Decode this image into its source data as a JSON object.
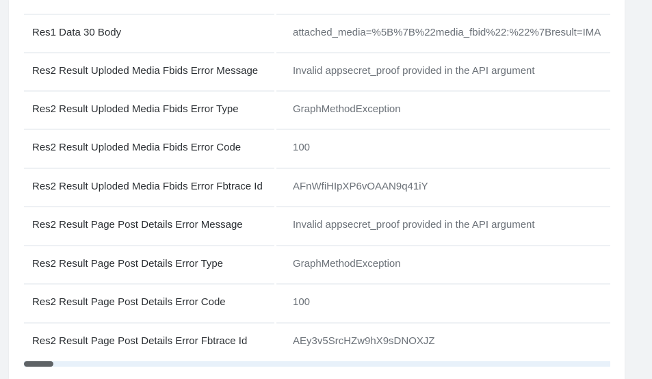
{
  "rows": [
    {
      "label": "Res1 Data 30 Body",
      "value": "attached_media=%5B%7B%22media_fbid%22:%22%7Bresult=IMA"
    },
    {
      "label": "Res2 Result Uploded Media Fbids Error Message",
      "value": "Invalid appsecret_proof provided in the API argument"
    },
    {
      "label": "Res2 Result Uploded Media Fbids Error Type",
      "value": "GraphMethodException"
    },
    {
      "label": "Res2 Result Uploded Media Fbids Error Code",
      "value": "100"
    },
    {
      "label": "Res2 Result Uploded Media Fbids Error Fbtrace Id",
      "value": "AFnWfiHIpXP6vOAAN9q41iY"
    },
    {
      "label": "Res2 Result Page Post Details Error Message",
      "value": "Invalid appsecret_proof provided in the API argument"
    },
    {
      "label": "Res2 Result Page Post Details Error Type",
      "value": "GraphMethodException"
    },
    {
      "label": "Res2 Result Page Post Details Error Code",
      "value": "100"
    },
    {
      "label": "Res2 Result Page Post Details Error Fbtrace Id",
      "value": "AEy3v5SrcHZw9hX9sDNOXJZ"
    }
  ],
  "scrollbar": {
    "position_fraction": 0.0
  }
}
